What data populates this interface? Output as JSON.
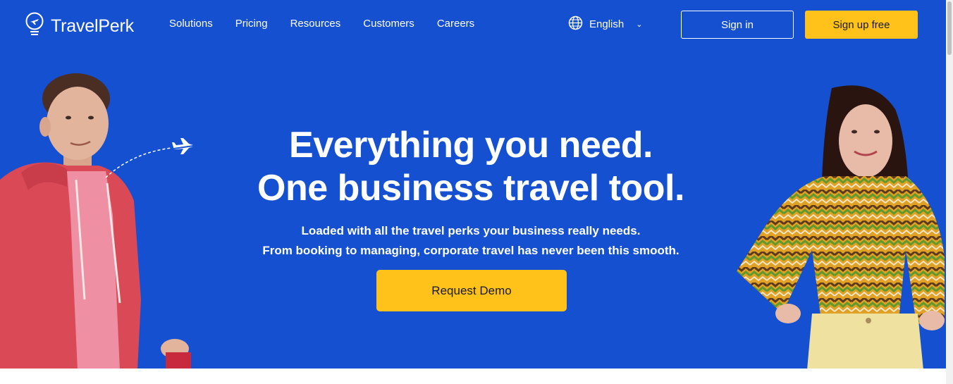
{
  "header": {
    "logo_text": "TravelPerk",
    "nav": [
      "Solutions",
      "Pricing",
      "Resources",
      "Customers",
      "Careers"
    ],
    "language": "English",
    "sign_in": "Sign in",
    "sign_up": "Sign up free"
  },
  "hero": {
    "headline_line1": "Everything you need.",
    "headline_line2": "One business travel tool.",
    "sub_line1": "Loaded with all the travel perks your business really needs.",
    "sub_line2": "From booking to managing, corporate travel has never been this smooth.",
    "cta": "Request Demo"
  },
  "colors": {
    "brand_blue": "#1450d0",
    "accent_yellow": "#ffc21a"
  },
  "icons": [
    "lightbulb-plane-logo-icon",
    "globe-icon",
    "chevron-down-icon",
    "airplane-icon"
  ]
}
